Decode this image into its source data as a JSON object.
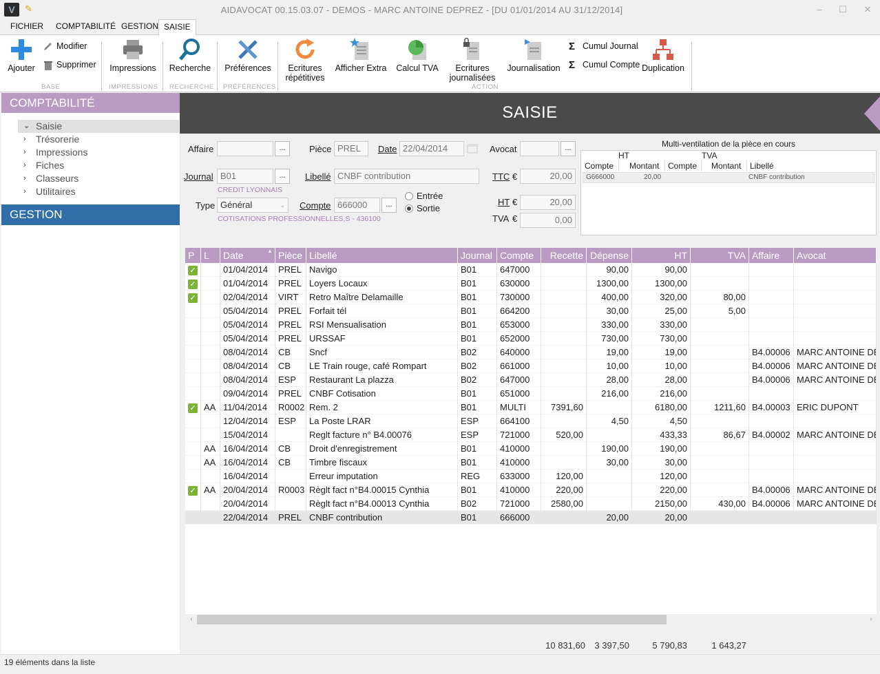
{
  "window": {
    "title": "AIDAVOCAT 00.15.03.07 - DEMOS - MARC ANTOINE DEPREZ - [DU 01/01/2014 AU 31/12/2014]"
  },
  "tabs": [
    "FICHIER",
    "COMPTABILITÉ",
    "GESTION",
    "SAISIE"
  ],
  "ribbon": {
    "ajouter": "Ajouter",
    "modifier": "Modifier",
    "supprimer": "Supprimer",
    "impressions": "Impressions",
    "recherche": "Recherche",
    "preferences": "Préférences",
    "ecritures_rep_1": "Ecritures",
    "ecritures_rep_2": "répétitives",
    "afficher_extra": "Afficher Extra",
    "calcul_tva": "Calcul TVA",
    "ecritures_journ_1": "Ecritures",
    "ecritures_journ_2": "journalisées",
    "journalisation": "Journalisation",
    "cumul_journal": "Cumul Journal",
    "cumul_compte": "Cumul Compte",
    "duplication": "Duplication",
    "groups": {
      "base": "BASE",
      "impressions": "IMPRESSIONS",
      "recherche": "RECHERCHE",
      "preferences": "PRÉFÉRENCES",
      "action": "ACTION"
    }
  },
  "sidebar": {
    "compta_title": "COMPTABILITÉ",
    "items": [
      "Saisie",
      "Trésorerie",
      "Impressions",
      "Fiches",
      "Classeurs",
      "Utilitaires"
    ],
    "gestion_title": "GESTION"
  },
  "main": {
    "title": "SAISIE"
  },
  "form": {
    "affaire_label": "Affaire",
    "affaire_value": "",
    "piece_label": "Pièce",
    "piece_value": "PREL",
    "date_label": "Date",
    "date_value": "22/04/2014",
    "avocat_label": "Avocat",
    "avocat_value": "",
    "journal_label": "Journal",
    "journal_value": "B01",
    "journal_sub": "CREDIT LYONNAIS",
    "libelle_label": "Libellé",
    "libelle_value": "CNBF contribution",
    "type_label": "Type",
    "type_value": "Général",
    "compte_label": "Compte",
    "compte_value": "666000",
    "compte_sub": "COTISATIONS PROFESSIONNELLES,S   - 436100",
    "entree_label": "Entrée",
    "sortie_label": "Sortie",
    "ttc_label": "TTC",
    "ttc_value": "20,00",
    "ht_label": "HT",
    "ht_value": "20,00",
    "tva_label": "TVA",
    "tva_value": "0,00",
    "euro": "€",
    "dots": "..."
  },
  "multiventilation": {
    "title": "Multi-ventilation de la pièce en cours",
    "group_ht": "HT",
    "group_tva": "TVA",
    "headers": [
      "Compte",
      "Montant",
      "Compte",
      "Montant",
      "Libellé"
    ],
    "row": [
      "G666000",
      "20,00",
      "",
      "",
      "CNBF contribution"
    ]
  },
  "grid": {
    "headers": [
      "P",
      "L",
      "Date",
      "Pièce",
      "Libellé",
      "Journal",
      "Compte",
      "Recette",
      "Dépense",
      "HT",
      "TVA",
      "Affaire",
      "Avocat"
    ],
    "sort_indicator": "▲",
    "rows": [
      {
        "p": true,
        "l": "",
        "date": "01/04/2014",
        "piece": "PREL",
        "libelle": "Navigo",
        "journal": "B01",
        "compte": "647000",
        "recette": "",
        "depense": "90,00",
        "ht": "90,00",
        "tva": "",
        "affaire": "",
        "avocat": ""
      },
      {
        "p": true,
        "l": "",
        "date": "01/04/2014",
        "piece": "PREL",
        "libelle": "Loyers Locaux",
        "journal": "B01",
        "compte": "630000",
        "recette": "",
        "depense": "1300,00",
        "ht": "1300,00",
        "tva": "",
        "affaire": "",
        "avocat": ""
      },
      {
        "p": true,
        "l": "",
        "date": "02/04/2014",
        "piece": "VIRT",
        "libelle": "Retro Maître Delamaille",
        "journal": "B01",
        "compte": "730000",
        "recette": "",
        "depense": "400,00",
        "ht": "320,00",
        "tva": "80,00",
        "affaire": "",
        "avocat": ""
      },
      {
        "p": false,
        "l": "",
        "date": "05/04/2014",
        "piece": "PREL",
        "libelle": "Forfait tél",
        "journal": "B01",
        "compte": "664200",
        "recette": "",
        "depense": "30,00",
        "ht": "25,00",
        "tva": "5,00",
        "affaire": "",
        "avocat": ""
      },
      {
        "p": false,
        "l": "",
        "date": "05/04/2014",
        "piece": "PREL",
        "libelle": "RSI Mensualisation",
        "journal": "B01",
        "compte": "653000",
        "recette": "",
        "depense": "330,00",
        "ht": "330,00",
        "tva": "",
        "affaire": "",
        "avocat": ""
      },
      {
        "p": false,
        "l": "",
        "date": "05/04/2014",
        "piece": "PREL",
        "libelle": "URSSAF",
        "journal": "B01",
        "compte": "652000",
        "recette": "",
        "depense": "730,00",
        "ht": "730,00",
        "tva": "",
        "affaire": "",
        "avocat": ""
      },
      {
        "p": false,
        "l": "",
        "date": "08/04/2014",
        "piece": "CB",
        "libelle": "Sncf",
        "journal": "B02",
        "compte": "640000",
        "recette": "",
        "depense": "19,00",
        "ht": "19,00",
        "tva": "",
        "affaire": "B4.00006",
        "avocat": "MARC ANTOINE DEPREZ"
      },
      {
        "p": false,
        "l": "",
        "date": "08/04/2014",
        "piece": "CB",
        "libelle": "LE Train rouge, café Rompart",
        "journal": "B02",
        "compte": "661000",
        "recette": "",
        "depense": "10,00",
        "ht": "10,00",
        "tva": "",
        "affaire": "B4.00006",
        "avocat": "MARC ANTOINE DEPREZ"
      },
      {
        "p": false,
        "l": "",
        "date": "08/04/2014",
        "piece": "ESP",
        "libelle": "Restaurant La plazza",
        "journal": "B02",
        "compte": "647000",
        "recette": "",
        "depense": "28,00",
        "ht": "28,00",
        "tva": "",
        "affaire": "B4.00006",
        "avocat": "MARC ANTOINE DEPREZ"
      },
      {
        "p": false,
        "l": "",
        "date": "09/04/2014",
        "piece": "PREL",
        "libelle": "CNBF Cotisation",
        "journal": "B01",
        "compte": "651000",
        "recette": "",
        "depense": "216,00",
        "ht": "216,00",
        "tva": "",
        "affaire": "",
        "avocat": ""
      },
      {
        "p": true,
        "l": "AA",
        "date": "11/04/2014",
        "piece": "R0002",
        "libelle": "Rem. 2",
        "journal": "B01",
        "compte": "MULTI",
        "recette": "7391,60",
        "depense": "",
        "ht": "6180,00",
        "tva": "1211,60",
        "affaire": "B4.00003",
        "avocat": "ERIC DUPONT"
      },
      {
        "p": false,
        "l": "",
        "date": "12/04/2014",
        "piece": "ESP",
        "libelle": "La Poste LRAR",
        "journal": "ESP",
        "compte": "664100",
        "recette": "",
        "depense": "4,50",
        "ht": "4,50",
        "tva": "",
        "affaire": "",
        "avocat": ""
      },
      {
        "p": false,
        "l": "",
        "date": "15/04/2014",
        "piece": "",
        "libelle": "Reglt facture n° B4.00076",
        "journal": "ESP",
        "compte": "721000",
        "recette": "520,00",
        "depense": "",
        "ht": "433,33",
        "tva": "86,67",
        "affaire": "B4.00002",
        "avocat": "MARC ANTOINE DEPREZ"
      },
      {
        "p": false,
        "l": "AA",
        "date": "16/04/2014",
        "piece": "CB",
        "libelle": "Droit d'enregistrement",
        "journal": "B01",
        "compte": "410000",
        "recette": "",
        "depense": "190,00",
        "ht": "190,00",
        "tva": "",
        "affaire": "",
        "avocat": ""
      },
      {
        "p": false,
        "l": "AA",
        "date": "16/04/2014",
        "piece": "CB",
        "libelle": "Timbre fiscaux",
        "journal": "B01",
        "compte": "410000",
        "recette": "",
        "depense": "30,00",
        "ht": "30,00",
        "tva": "",
        "affaire": "",
        "avocat": ""
      },
      {
        "p": false,
        "l": "",
        "date": "16/04/2014",
        "piece": "",
        "libelle": "Erreur imputation",
        "journal": "REG",
        "compte": "633000",
        "recette": "120,00",
        "depense": "",
        "ht": "120,00",
        "tva": "",
        "affaire": "",
        "avocat": ""
      },
      {
        "p": true,
        "l": "AA",
        "date": "20/04/2014",
        "piece": "R0003",
        "libelle": "Règlt fact n°B4.00015 Cynthia",
        "journal": "B01",
        "compte": "410000",
        "recette": "220,00",
        "depense": "",
        "ht": "220,00",
        "tva": "",
        "affaire": "B4.00006",
        "avocat": "MARC ANTOINE DEPREZ"
      },
      {
        "p": false,
        "l": "",
        "date": "20/04/2014",
        "piece": "",
        "libelle": "Règlt fact n°B4.00013 Cynthia",
        "journal": "B02",
        "compte": "721000",
        "recette": "2580,00",
        "depense": "",
        "ht": "2150,00",
        "tva": "430,00",
        "affaire": "B4.00006",
        "avocat": "MARC ANTOINE DEPREZ"
      },
      {
        "p": false,
        "l": "",
        "date": "22/04/2014",
        "piece": "PREL",
        "libelle": "CNBF contribution",
        "journal": "B01",
        "compte": "666000",
        "recette": "",
        "depense": "20,00",
        "ht": "20,00",
        "tva": "",
        "affaire": "",
        "avocat": "",
        "selected": true
      }
    ],
    "checkmark": "✓"
  },
  "totals": {
    "recette": "10 831,60",
    "depense": "3 397,50",
    "ht": "5 790,83",
    "tva": "1 643,27"
  },
  "status": {
    "text": "19 éléments dans la liste"
  },
  "colors": {
    "accent_purple": "#b99ac2",
    "gestion_blue": "#2f6ea6",
    "header_dark": "#4a4a4a",
    "check_green": "#7bb23a"
  }
}
